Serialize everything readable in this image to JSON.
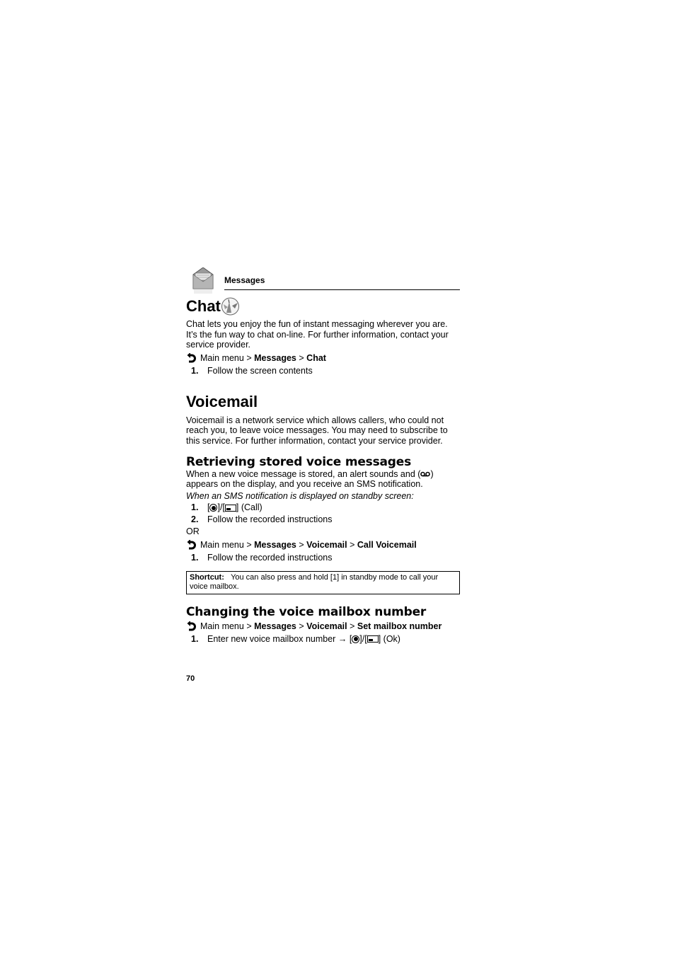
{
  "header": {
    "section": "Messages",
    "icon": "envelope-icon"
  },
  "chat": {
    "title": "Chat",
    "title_icon": "chat-icon",
    "intro": "Chat lets you enjoy the fun of instant messaging wherever you are. It’s the fun way to chat on-line. For further information, contact your service provider.",
    "nav": {
      "prefix": "Main menu",
      "sep": ">",
      "path": [
        "Messages",
        "Chat"
      ]
    },
    "steps": [
      {
        "num": "1.",
        "text": "Follow the screen contents"
      }
    ]
  },
  "voicemail": {
    "title": "Voicemail",
    "intro": "Voicemail is a network service which allows callers, who could not reach you, to leave voice messages. You may need to subscribe to this service. For further information, contact your service provider.",
    "retrieving": {
      "title": "Retrieving stored voice messages",
      "text_before_icon": "When a new voice message is stored, an alert sounds and (",
      "text_after_icon": ") appears on the display, and you receive an SMS notification.",
      "icon": "voicemail-icon",
      "condition": "When an SMS notification is displayed on standby screen:",
      "steps": [
        {
          "num": "1.",
          "open": "[",
          "mid": "]/[",
          "close": "] (Call)"
        },
        {
          "num": "2.",
          "text": "Follow the recorded instructions"
        }
      ],
      "or": "OR",
      "nav": {
        "prefix": "Main menu",
        "sep": ">",
        "path": [
          "Messages",
          "Voicemail",
          "Call Voicemail"
        ]
      },
      "steps2": [
        {
          "num": "1.",
          "text": "Follow the recorded instructions"
        }
      ],
      "shortcut": {
        "label": "Shortcut:",
        "text": "You can also press and hold [1] in standby mode to call your voice mailbox."
      }
    },
    "changing": {
      "title": "Changing the voice mailbox number",
      "nav": {
        "prefix": "Main menu",
        "sep": ">",
        "path": [
          "Messages",
          "Voicemail",
          "Set mailbox number"
        ]
      },
      "steps": [
        {
          "num": "1.",
          "text": "Enter new voice mailbox number",
          "arrow": "→",
          "open": "[",
          "mid": "]/[",
          "close": "] (Ok)"
        }
      ]
    }
  },
  "page_number": "70"
}
